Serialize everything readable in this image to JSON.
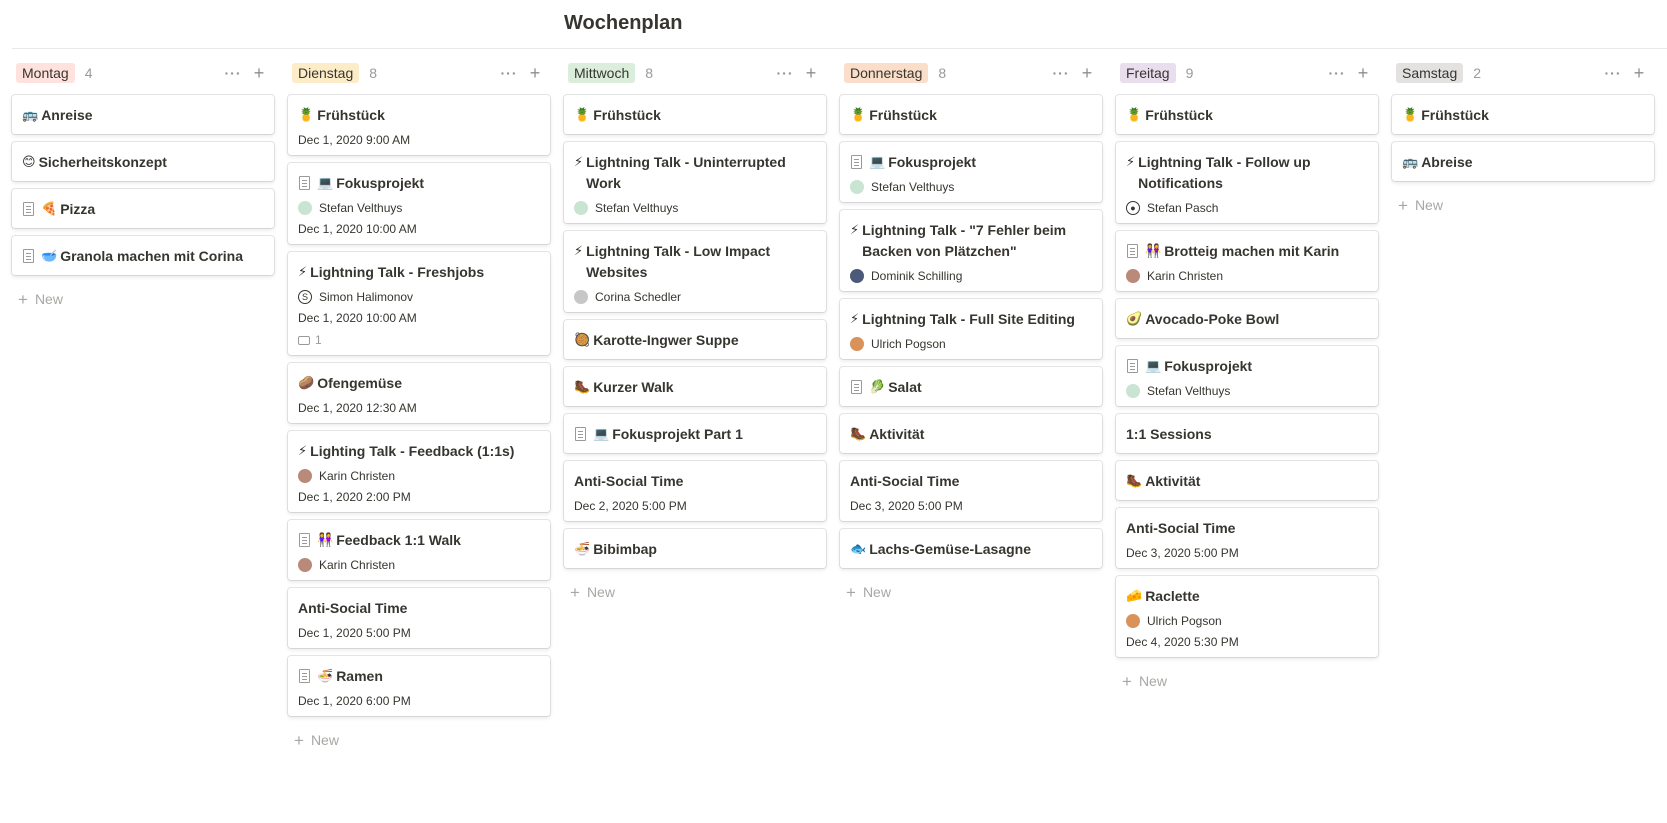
{
  "page": {
    "title": "Wochenplan"
  },
  "board": {
    "new_label": "New",
    "columns": [
      {
        "name": "Montag",
        "count": "4",
        "color": "#ffe2dd",
        "cards": [
          {
            "emoji": "🚌",
            "title": "Anreise"
          },
          {
            "emoji": "😊",
            "title": "Sicherheitskonzept"
          },
          {
            "doc": true,
            "emoji": "🍕",
            "title": "Pizza"
          },
          {
            "doc": true,
            "emoji": "🥣",
            "title": "Granola machen mit Corina"
          }
        ]
      },
      {
        "name": "Dienstag",
        "count": "8",
        "color": "#fdecc8",
        "cards": [
          {
            "emoji": "🍍",
            "title": "Frühstück",
            "date": "Dec 1, 2020 9:00 AM"
          },
          {
            "doc": true,
            "emoji": "💻",
            "title": "Fokusprojekt",
            "person": "Stefan Velthuys",
            "avatar": "#c9e4d3",
            "date": "Dec 1, 2020 10:00 AM"
          },
          {
            "emoji": "⚡",
            "title": "Lightning Talk - Freshjobs",
            "person": "Simon Halimonov",
            "avatar": "#ffffff",
            "avatar_letter": "S",
            "date": "Dec 1, 2020 10:00 AM",
            "comments": "1"
          },
          {
            "emoji": "🥔",
            "title": "Ofengemüse",
            "date": "Dec 1, 2020 12:30 AM"
          },
          {
            "emoji": "⚡",
            "title": "Lighting Talk - Feedback (1:1s)",
            "person": "Karin Christen",
            "avatar": "#b98a7a",
            "date": "Dec 1, 2020 2:00 PM"
          },
          {
            "doc": true,
            "emoji": "👭",
            "title": "Feedback 1:1 Walk",
            "person": "Karin Christen",
            "avatar": "#b98a7a"
          },
          {
            "title": "Anti-Social Time",
            "date": "Dec 1, 2020 5:00 PM"
          },
          {
            "doc": true,
            "emoji": "🍜",
            "title": "Ramen",
            "date": "Dec 1, 2020 6:00 PM"
          }
        ]
      },
      {
        "name": "Mittwoch",
        "count": "8",
        "color": "#dbeddb",
        "cards": [
          {
            "emoji": "🍍",
            "title": "Frühstück"
          },
          {
            "emoji": "⚡",
            "title": "Lightning Talk - Uninterrupted Work",
            "person": "Stefan Velthuys",
            "avatar": "#c9e4d3"
          },
          {
            "emoji": "⚡",
            "title": "Lightning Talk - Low Impact Websites",
            "person": "Corina Schedler",
            "avatar": "#c7c7c7"
          },
          {
            "emoji": "🥘",
            "title": "Karotte-Ingwer Suppe"
          },
          {
            "emoji": "🥾",
            "title": "Kurzer Walk"
          },
          {
            "doc": true,
            "emoji": "💻",
            "title": "Fokusprojekt Part 1"
          },
          {
            "title": "Anti-Social Time",
            "date": "Dec 2, 2020 5:00 PM"
          },
          {
            "emoji": "🍜",
            "title": "Bibimbap"
          }
        ]
      },
      {
        "name": "Donnerstag",
        "count": "8",
        "color": "#fadec9",
        "cards": [
          {
            "emoji": "🍍",
            "title": "Frühstück"
          },
          {
            "doc": true,
            "emoji": "💻",
            "title": "Fokusprojekt",
            "person": "Stefan Velthuys",
            "avatar": "#c9e4d3"
          },
          {
            "emoji": "⚡",
            "title": "Lightning Talk - \"7 Fehler beim Backen von Plätzchen\"",
            "person": "Dominik Schilling",
            "avatar": "#4a5a78"
          },
          {
            "emoji": "⚡",
            "title": "Lightning Talk - Full Site Editing",
            "person": "Ulrich Pogson",
            "avatar": "#d9925a"
          },
          {
            "doc": true,
            "emoji": "🥬",
            "title": "Salat"
          },
          {
            "emoji": "🥾",
            "title": "Aktivität"
          },
          {
            "title": "Anti-Social Time",
            "date": "Dec 3, 2020 5:00 PM"
          },
          {
            "emoji": "🐟",
            "title": "Lachs-Gemüse-Lasagne"
          }
        ]
      },
      {
        "name": "Freitag",
        "count": "9",
        "color": "#e8deee",
        "cards": [
          {
            "emoji": "🍍",
            "title": "Frühstück"
          },
          {
            "emoji": "⚡",
            "title": "Lightning Talk - Follow up Notifications",
            "person": "Stefan Pasch",
            "avatar": "#ffffff",
            "avatar_letter": "●"
          },
          {
            "doc": true,
            "emoji": "👭",
            "title": "Brotteig machen mit Karin",
            "person": "Karin Christen",
            "avatar": "#b98a7a"
          },
          {
            "emoji": "🥑",
            "title": "Avocado-Poke Bowl"
          },
          {
            "doc": true,
            "emoji": "💻",
            "title": "Fokusprojekt",
            "person": "Stefan Velthuys",
            "avatar": "#c9e4d3"
          },
          {
            "title": "1:1 Sessions"
          },
          {
            "emoji": "🥾",
            "title": "Aktivität"
          },
          {
            "title": "Anti-Social Time",
            "date": "Dec 3, 2020 5:00 PM"
          },
          {
            "emoji": "🧀",
            "title": "Raclette",
            "person": "Ulrich Pogson",
            "avatar": "#d9925a",
            "date": "Dec 4, 2020 5:30 PM"
          }
        ]
      },
      {
        "name": "Samstag",
        "count": "2",
        "color": "#e3e2e0",
        "cards": [
          {
            "emoji": "🍍",
            "title": "Frühstück"
          },
          {
            "emoji": "🚌",
            "title": "Abreise"
          }
        ]
      }
    ]
  }
}
